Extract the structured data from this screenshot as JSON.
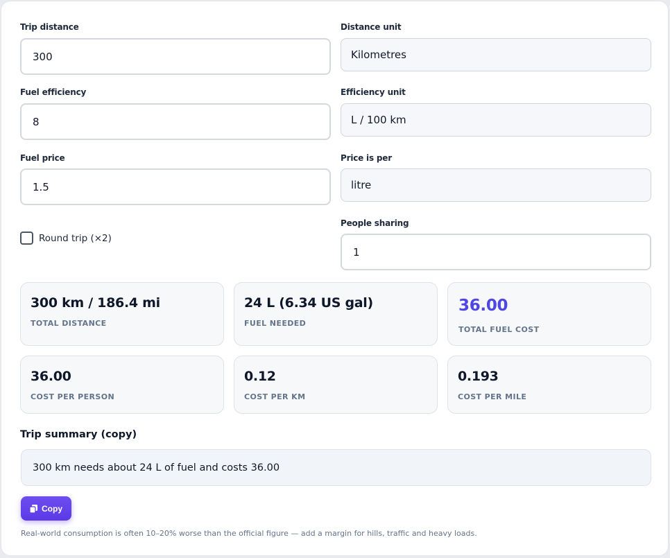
{
  "form": {
    "trip_distance": {
      "label": "Trip distance",
      "value": "300"
    },
    "distance_unit": {
      "label": "Distance unit",
      "value": "Kilometres"
    },
    "fuel_efficiency": {
      "label": "Fuel efficiency",
      "value": "8"
    },
    "efficiency_unit": {
      "label": "Efficiency unit",
      "value": "L / 100 km"
    },
    "fuel_price": {
      "label": "Fuel price",
      "value": "1.5"
    },
    "price_per": {
      "label": "Price is per",
      "value": "litre"
    },
    "round_trip": {
      "label": "Round trip (×2)",
      "checked": false
    },
    "people_sharing": {
      "label": "People sharing",
      "value": "1"
    }
  },
  "stats": [
    {
      "value": "300 km / 186.4 mi",
      "caption": "TOTAL DISTANCE"
    },
    {
      "value": "24 L (6.34 US gal)",
      "caption": "FUEL NEEDED"
    },
    {
      "value": "36.00",
      "caption": "TOTAL FUEL COST"
    },
    {
      "value": "36.00",
      "caption": "COST PER PERSON"
    },
    {
      "value": "0.12",
      "caption": "COST PER KM"
    },
    {
      "value": "0.193",
      "caption": "COST PER MILE"
    }
  ],
  "summary": {
    "title": "Trip summary (copy)",
    "text": "300 km needs about 24 L of fuel and costs 36.00"
  },
  "copy_button": {
    "label": "Copy",
    "icon": "copy-icon"
  },
  "note": "Real-world consumption is often 10–20% worse than the official figure — add a margin for hills, traffic and heavy loads.",
  "colors": {
    "accent": "#4f46e5",
    "button": "#5b3ae6"
  }
}
